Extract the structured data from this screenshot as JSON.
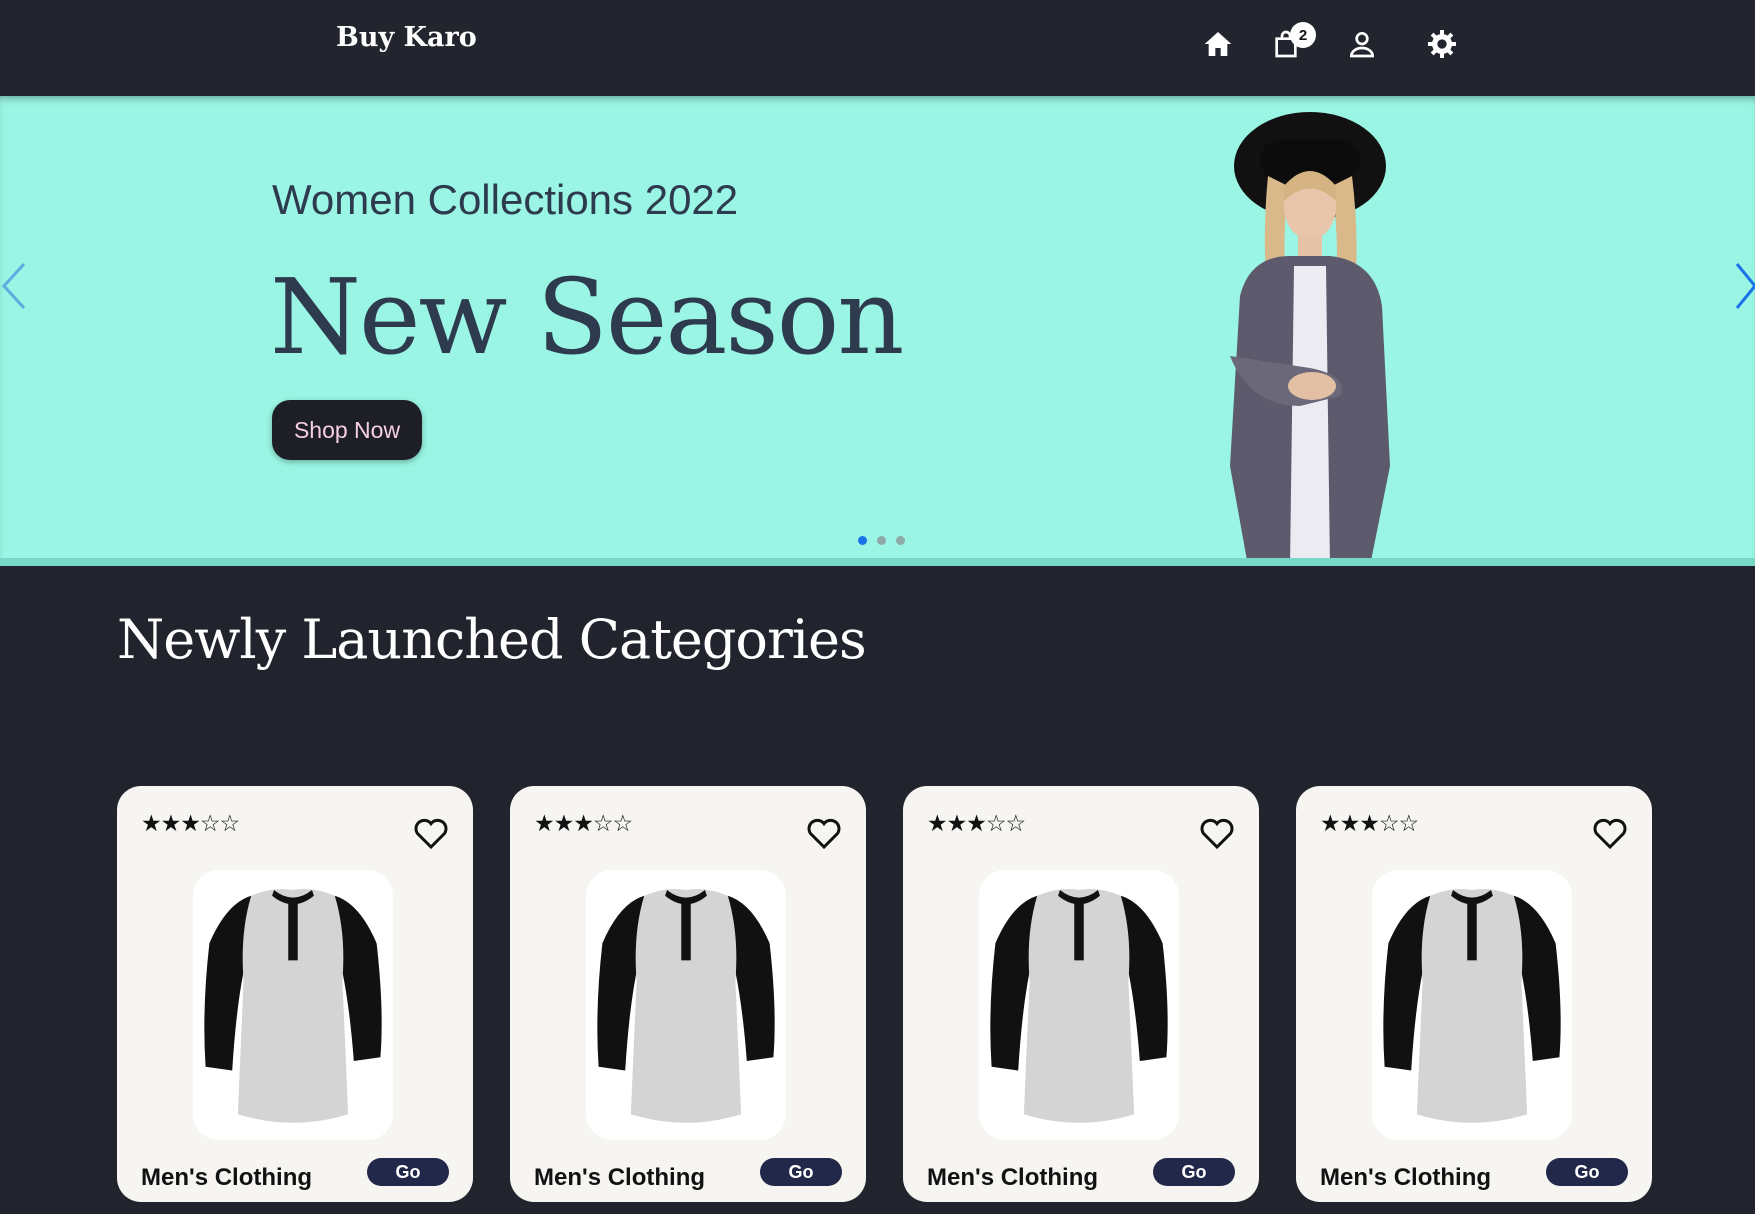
{
  "header": {
    "brand": "Buy Karo",
    "cart_count": "2",
    "icons": [
      "home-icon",
      "cart-icon",
      "user-icon",
      "settings-icon"
    ]
  },
  "hero": {
    "subtitle": "Women Collections 2022",
    "title": "New Season",
    "button_label": "Shop Now",
    "background_color": "#9af5e4",
    "slide_count": 3,
    "active_slide": 0
  },
  "section": {
    "title": "Newly Launched Categories"
  },
  "cards": [
    {
      "label": "Men's Clothing",
      "button": "Go",
      "rating": 3,
      "max_rating": 5,
      "stars": "★★★☆☆"
    },
    {
      "label": "Men's Clothing",
      "button": "Go",
      "rating": 3,
      "max_rating": 5,
      "stars": "★★★☆☆"
    },
    {
      "label": "Men's Clothing",
      "button": "Go",
      "rating": 3,
      "max_rating": 5,
      "stars": "★★★☆☆"
    },
    {
      "label": "Men's Clothing",
      "button": "Go",
      "rating": 3,
      "max_rating": 5,
      "stars": "★★★☆☆"
    }
  ],
  "colors": {
    "header_bg": "#22242e",
    "page_bg": "#21232d",
    "card_bg": "#f7f5f2",
    "go_button": "#22284a",
    "active_dot": "#1a73e8"
  }
}
